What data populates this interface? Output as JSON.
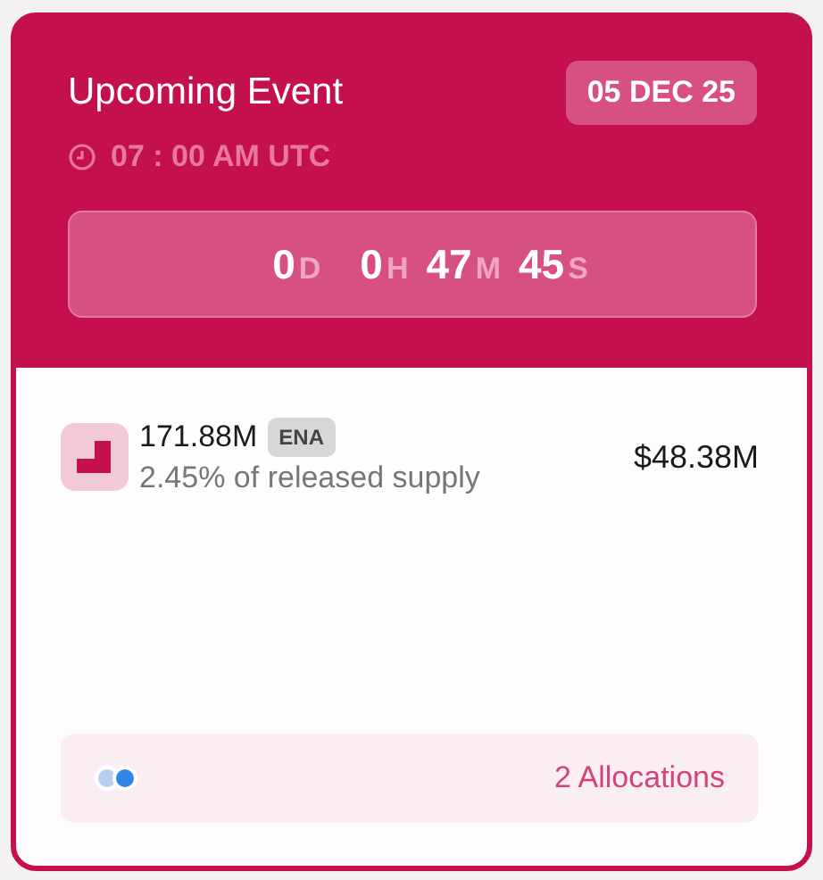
{
  "event": {
    "title": "Upcoming Event",
    "date": "05 DEC 25",
    "time": "07 : 00 AM UTC",
    "countdown": [
      {
        "value": "0",
        "unit": "D"
      },
      {
        "value": "0",
        "unit": "H"
      },
      {
        "value": "47",
        "unit": "M"
      },
      {
        "value": "45",
        "unit": "S"
      }
    ]
  },
  "unlock": {
    "amount": "171.88M",
    "token": "ENA",
    "share": "2.45% of released supply",
    "value": "$48.38M"
  },
  "allocations": {
    "label": "2 Allocations"
  }
}
